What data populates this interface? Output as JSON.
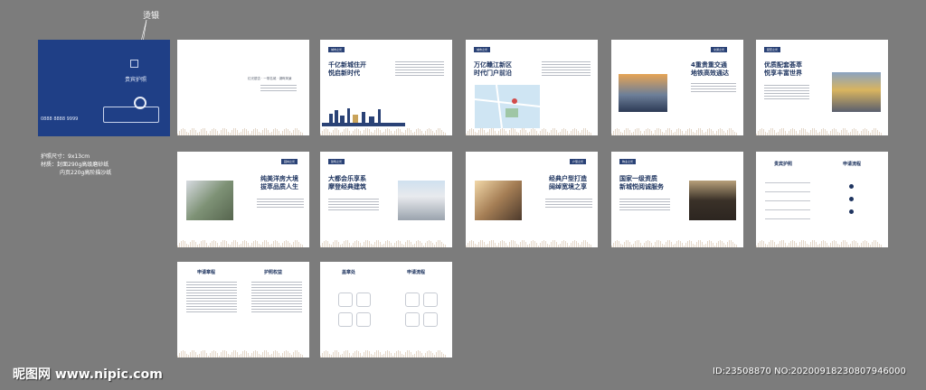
{
  "annotation": {
    "label": "烫银"
  },
  "spec": {
    "size": "护照尺寸：9x13cm",
    "material": "材质：封面290g高级磨砂纸",
    "inner": "内页220g高阶描沙纸"
  },
  "cover": {
    "title": "贵宾护照",
    "phone": "0888 8888 9999"
  },
  "pages": {
    "p2": {
      "text": "红光银杏 · 一带名城 · 湖畔风景"
    },
    "p3": {
      "tag": "城市之光",
      "title": "千亿新城住开\n悦启新时代"
    },
    "p4": {
      "tag": "城市之光",
      "title": "万亿赣江新区\n时代门户前沿"
    },
    "p5": {
      "tag": "交通之光",
      "title": "4重贵重交通\n地铁高效通达"
    },
    "p6": {
      "tag": "配套之光",
      "title": "优质配套荟萃\n悦享丰富世界"
    },
    "p7": {
      "tag": "园林之光",
      "title": "纯美洋房大境\n拔萃品质人生"
    },
    "p8": {
      "tag": "建筑之光",
      "title": "大都会乐享系\n摩登经典建筑"
    },
    "p9": {
      "tag": "户型之光",
      "title": "经典户型打造\n阔绰宽境之享"
    },
    "p10": {
      "tag": "物业之光",
      "title": "国家一级资质\n新城悦阅诚服务"
    },
    "p11": {
      "title": "贵宾护照"
    },
    "p12": {
      "title": "申请流程"
    },
    "p13": {
      "title": "申请章程"
    },
    "p14": {
      "title": "护照权益"
    },
    "p15": {
      "title": "盖章处"
    },
    "p16": {
      "title": "申请流程"
    }
  },
  "watermark": {
    "site": "昵图网 www.nipic.com",
    "id": "ID:23508870 NO:20200918230807946000"
  },
  "colors": {
    "background": "#7c7c7c",
    "navy": "#1f3560",
    "cover": "#1f3f86"
  }
}
